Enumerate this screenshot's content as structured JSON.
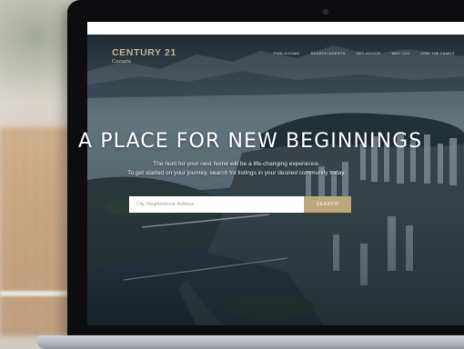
{
  "brand": {
    "name": "CENTURY 21",
    "region": "Canada"
  },
  "nav": {
    "items": [
      {
        "label": "FIND A HOME"
      },
      {
        "label": "SEARCH AGENTS"
      },
      {
        "label": "GET ADVICE"
      },
      {
        "label": "WHY C21"
      },
      {
        "label": "JOIN THE FAMILY"
      }
    ]
  },
  "hero": {
    "headline": "A PLACE FOR NEW BEGINNINGS",
    "tagline_line1": "The hunt for your next home will be a life-changing experience.",
    "tagline_line2": "To get started on your journey, search for listings in your desired community today."
  },
  "search": {
    "placeholder": "City, Neighborhood, Address",
    "value": "",
    "button_label": "SEARCH"
  },
  "colors": {
    "accent": "#bda879",
    "brand_gold": "#c7b38a"
  }
}
